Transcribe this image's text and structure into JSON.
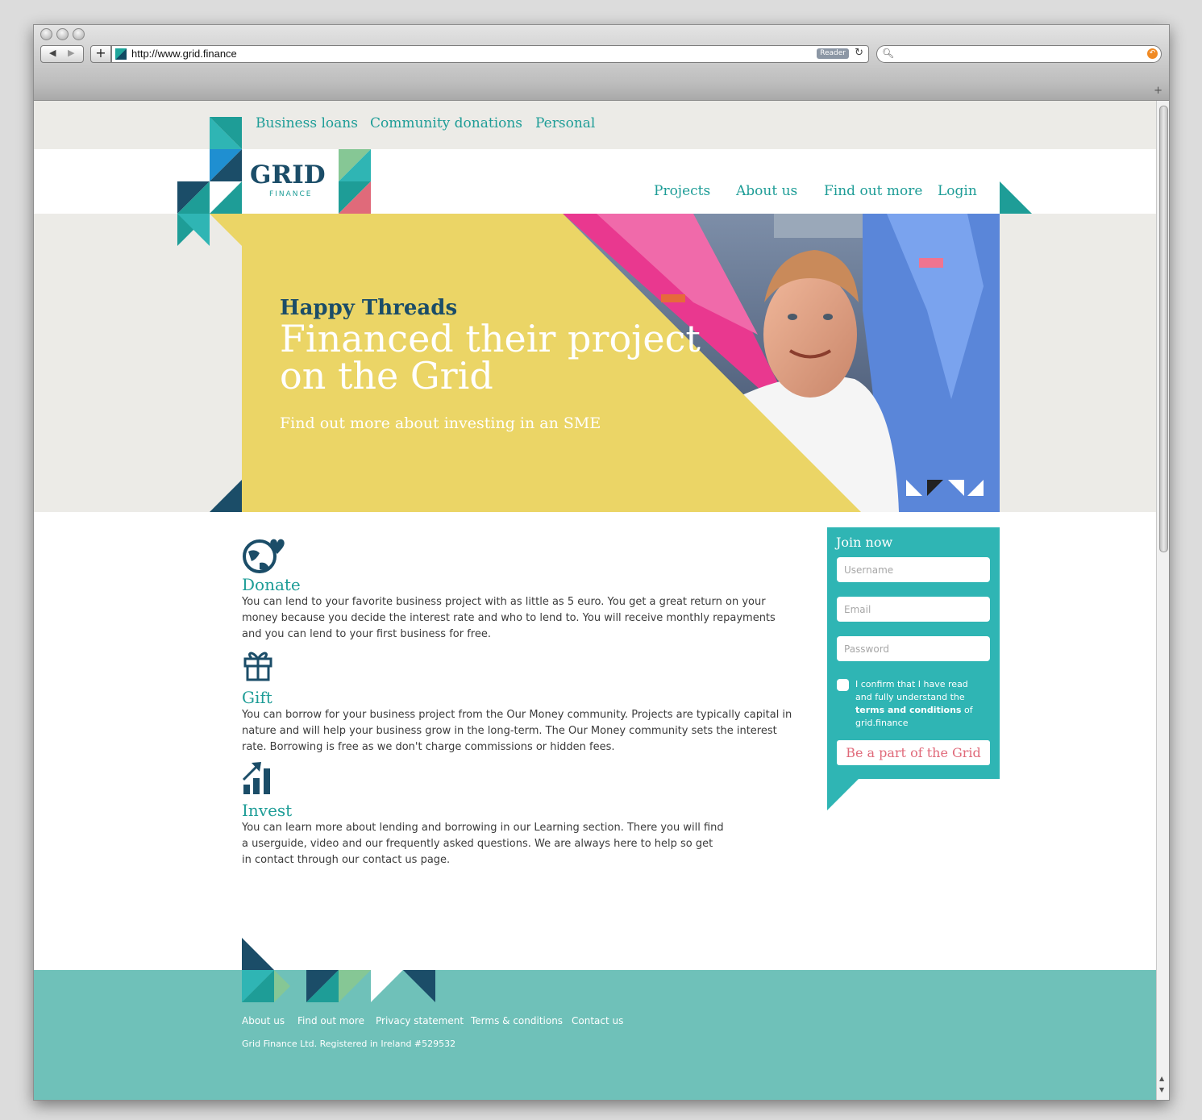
{
  "browser": {
    "url": "http://www.grid.finance",
    "reader_label": "Reader"
  },
  "site": {
    "logo": {
      "word": "GRID",
      "sub": "FINANCE"
    },
    "top_nav": [
      "Business loans",
      "Community donations",
      "Personal"
    ],
    "main_nav": [
      "Projects",
      "About us",
      "Find out more",
      "Login"
    ]
  },
  "hero": {
    "kicker": "Happy Threads",
    "title": "Financed their project on the Grid",
    "link": "Find out more about investing in an SME"
  },
  "features": [
    {
      "icon": "globe-heart-icon",
      "title": "Donate",
      "text": "You can lend to your favorite business project with as little as 5 euro. You get a great return on your money because you decide the interest rate and who to lend to. You will receive monthly repayments and you can lend to your first business for free."
    },
    {
      "icon": "gift-icon",
      "title": "Gift",
      "text": "You can borrow for your business project from the Our Money community. Projects are typically capital in nature and will help your business grow in the long-term. The Our Money community sets the interest rate. Borrowing is free as we don't charge commissions or hidden fees."
    },
    {
      "icon": "growth-chart-icon",
      "title": "Invest",
      "text": "You can learn more about lending and borrowing in our Learning section. There you will find a userguide, video and our frequently asked questions. We are always here to help so get in contact through our contact us page."
    }
  ],
  "join": {
    "title": "Join now",
    "username_placeholder": "Username",
    "email_placeholder": "Email",
    "password_placeholder": "Password",
    "confirm_prefix": "I confirm that I have read and fully understand the",
    "confirm_bold": "terms and conditions",
    "confirm_suffix": "of grid.finance",
    "button": "Be a part of the Grid"
  },
  "footer": {
    "links": [
      "About us",
      "Find out more",
      "Privacy statement",
      "Terms & conditions",
      "Contact us"
    ],
    "copyright": "Grid Finance Ltd. Registered in Ireland #529532"
  },
  "colors": {
    "teal": "#1e9d97",
    "navy": "#1b4d68",
    "yellow": "#ebd566",
    "join_teal": "#2fb5b4",
    "footer_teal": "#6fc1b9",
    "pink": "#e06a7a"
  }
}
